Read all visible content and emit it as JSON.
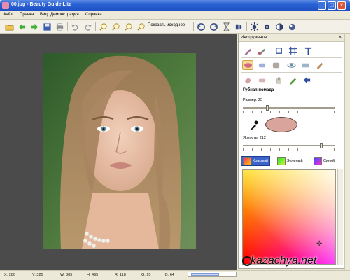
{
  "window": {
    "title": "00.jpg - Beauty Guide Lite"
  },
  "menu": {
    "items": [
      "Файл",
      "Правка",
      "Вид",
      "Демонстрация",
      "Справка"
    ]
  },
  "toolbar": {
    "show_original_label": "Показать исходное"
  },
  "panel": {
    "title": "Инструменты",
    "tool_name": "Губная помада",
    "size_label": "Размер: 25",
    "size_value": 25,
    "brightness_label": "Яркость: 212",
    "brightness_value": 212,
    "swatch_color": "#d9a49b",
    "tabs": {
      "red": "Красный",
      "green": "Зеленый",
      "blue": "Синий"
    }
  },
  "status": {
    "x": "X: 286",
    "y": "Y: 325",
    "w": "W: 385",
    "h": "H: 495",
    "r": "R: 118",
    "g": "G: 95",
    "b": "B: 64"
  },
  "watermark": "kazachya.net",
  "colors": {
    "accent": "#3c63c9",
    "canvas_bg": "#4b4b4b",
    "titlebar": "#2a62d4"
  }
}
